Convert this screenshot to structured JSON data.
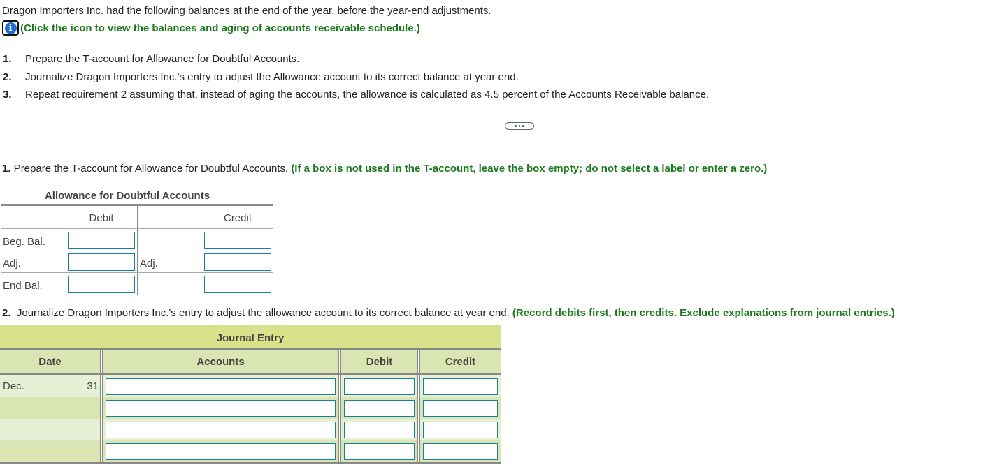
{
  "intro": "Dragon Importers Inc. had the following balances at the end of the year, before the year-end adjustments.",
  "info": {
    "icon": "info-icon",
    "text": "(Click the icon to view the balances and aging of accounts receivable schedule.)"
  },
  "requirements": [
    {
      "num": "1.",
      "text": "Prepare the T-account for Allowance for Doubtful Accounts."
    },
    {
      "num": "2.",
      "text": "Journalize Dragon Importers Inc.'s entry to adjust the Allowance account to its correct balance at year end."
    },
    {
      "num": "3.",
      "text": "Repeat requirement 2 assuming that, instead of aging the accounts, the allowance is calculated as 4.5 percent of the Accounts Receivable balance."
    }
  ],
  "more_button": "...",
  "question1": {
    "num": "1.",
    "text": " Prepare the T-account for Allowance for Doubtful Accounts. ",
    "instruction": "(If a box is not used in the T-account, leave the box empty; do not select a label or enter a zero.)"
  },
  "taccount": {
    "title": "Allowance for Doubtful Accounts",
    "debit_header": "Debit",
    "credit_header": "Credit",
    "rows": [
      {
        "left_label": "Beg. Bal.",
        "debit_value": "",
        "right_label": "",
        "credit_value": ""
      },
      {
        "left_label": "Adj.",
        "debit_value": "",
        "right_label": "Adj.",
        "credit_value": ""
      },
      {
        "left_label": "End Bal.",
        "debit_value": "",
        "right_label": "",
        "credit_value": ""
      }
    ]
  },
  "question2": {
    "num": "2.",
    "text": "  Journalize Dragon Importers Inc.'s entry to adjust the allowance account to its correct balance at year end. ",
    "instruction": "(Record debits first, then credits. Exclude explanations from journal entries.)"
  },
  "journal": {
    "title": "Journal Entry",
    "headers": {
      "date": "Date",
      "accounts": "Accounts",
      "debit": "Debit",
      "credit": "Credit"
    },
    "rows": [
      {
        "month": "Dec.",
        "day": "31",
        "account": "",
        "debit": "",
        "credit": ""
      },
      {
        "month": "",
        "day": "",
        "account": "",
        "debit": "",
        "credit": ""
      },
      {
        "month": "",
        "day": "",
        "account": "",
        "debit": "",
        "credit": ""
      },
      {
        "month": "",
        "day": "",
        "account": "",
        "debit": "",
        "credit": ""
      }
    ]
  }
}
